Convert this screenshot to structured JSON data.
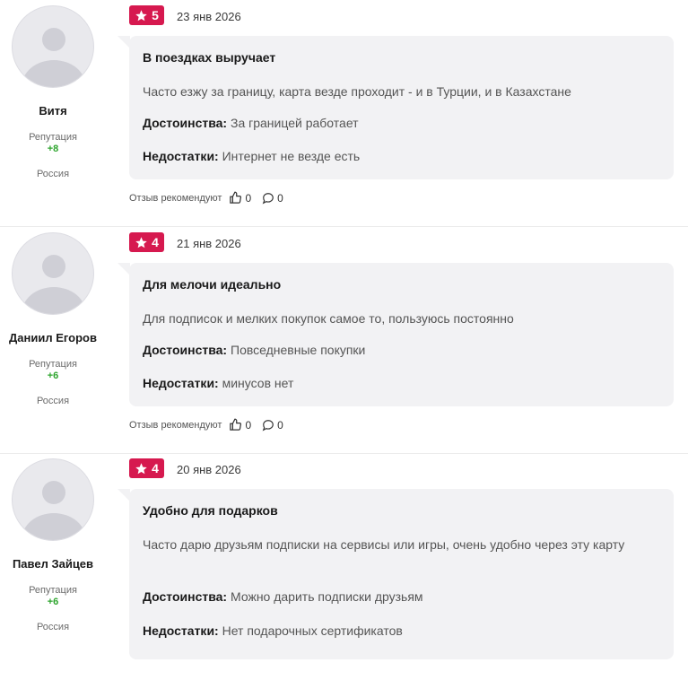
{
  "reviews": [
    {
      "author": "Витя",
      "reputation_label": "Репутация",
      "reputation_value": "+8",
      "country": "Россия",
      "rating": "5",
      "date": "23 янв 2026",
      "title": "В поездках выручает",
      "text": "Часто езжу за границу, карта везде проходит - и в Турции, и в Казахстане",
      "pros_label": "Достоинства:",
      "pros": "За границей работает",
      "cons_label": "Недостатки:",
      "cons": "Интернет не везде есть",
      "recommend_label": "Отзыв рекомендуют",
      "likes": "0",
      "comments": "0"
    },
    {
      "author": "Даниил Егоров",
      "reputation_label": "Репутация",
      "reputation_value": "+6",
      "country": "Россия",
      "rating": "4",
      "date": "21 янв 2026",
      "title": "Для мелочи идеально",
      "text": "Для подписок и мелких покупок самое то, пользуюсь постоянно",
      "pros_label": "Достоинства:",
      "pros": "Повседневные покупки",
      "cons_label": "Недостатки:",
      "cons": "минусов нет",
      "recommend_label": "Отзыв рекомендуют",
      "likes": "0",
      "comments": "0"
    },
    {
      "author": "Павел Зайцев",
      "reputation_label": "Репутация",
      "reputation_value": "+6",
      "country": "Россия",
      "rating": "4",
      "date": "20 янв 2026",
      "title": "Удобно для подарков",
      "text": "Часто дарю друзьям подписки на сервисы или игры, очень удобно через эту карту",
      "pros_label": "Достоинства:",
      "pros": "Можно дарить подписки друзьям",
      "cons_label": "Недостатки:",
      "cons": "Нет подарочных сертификатов",
      "recommend_label": "",
      "likes": "",
      "comments": ""
    }
  ],
  "colors": {
    "badge": "#d6194f",
    "card_bg": "#f2f2f4",
    "reputation": "#2ea52e"
  }
}
